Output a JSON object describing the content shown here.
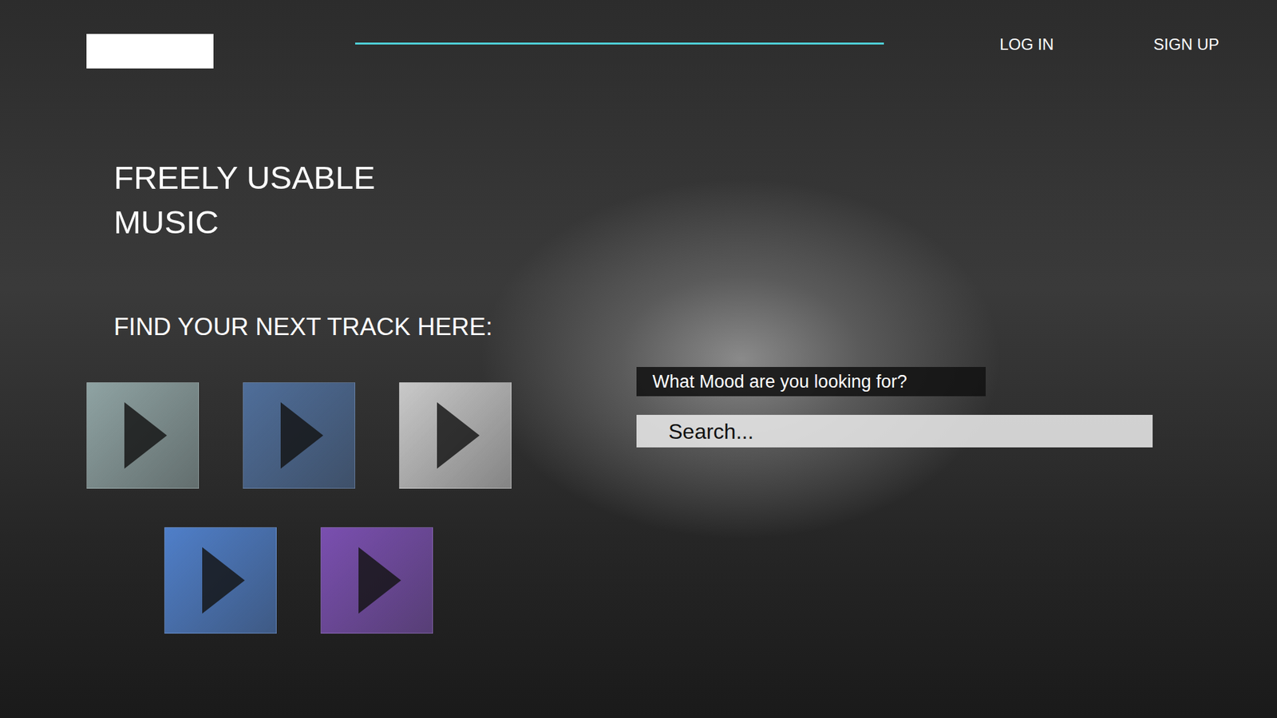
{
  "header": {
    "nav": [
      "LOG IN",
      "SIGN UP"
    ]
  },
  "hero": {
    "title_lines": [
      "FREELY USABLE",
      "MUSIC"
    ],
    "subtitle": "FIND YOUR NEXT TRACK HERE:"
  },
  "tracks": [
    {
      "color": "#8fa3a3"
    },
    {
      "color": "#4f6e9a"
    },
    {
      "color": "#c9c9c9"
    },
    {
      "color": "#4f7fc9"
    },
    {
      "color": "#7a4fb0"
    }
  ],
  "search": {
    "label": "What Mood are you looking for?",
    "placeholder": "Search..."
  }
}
